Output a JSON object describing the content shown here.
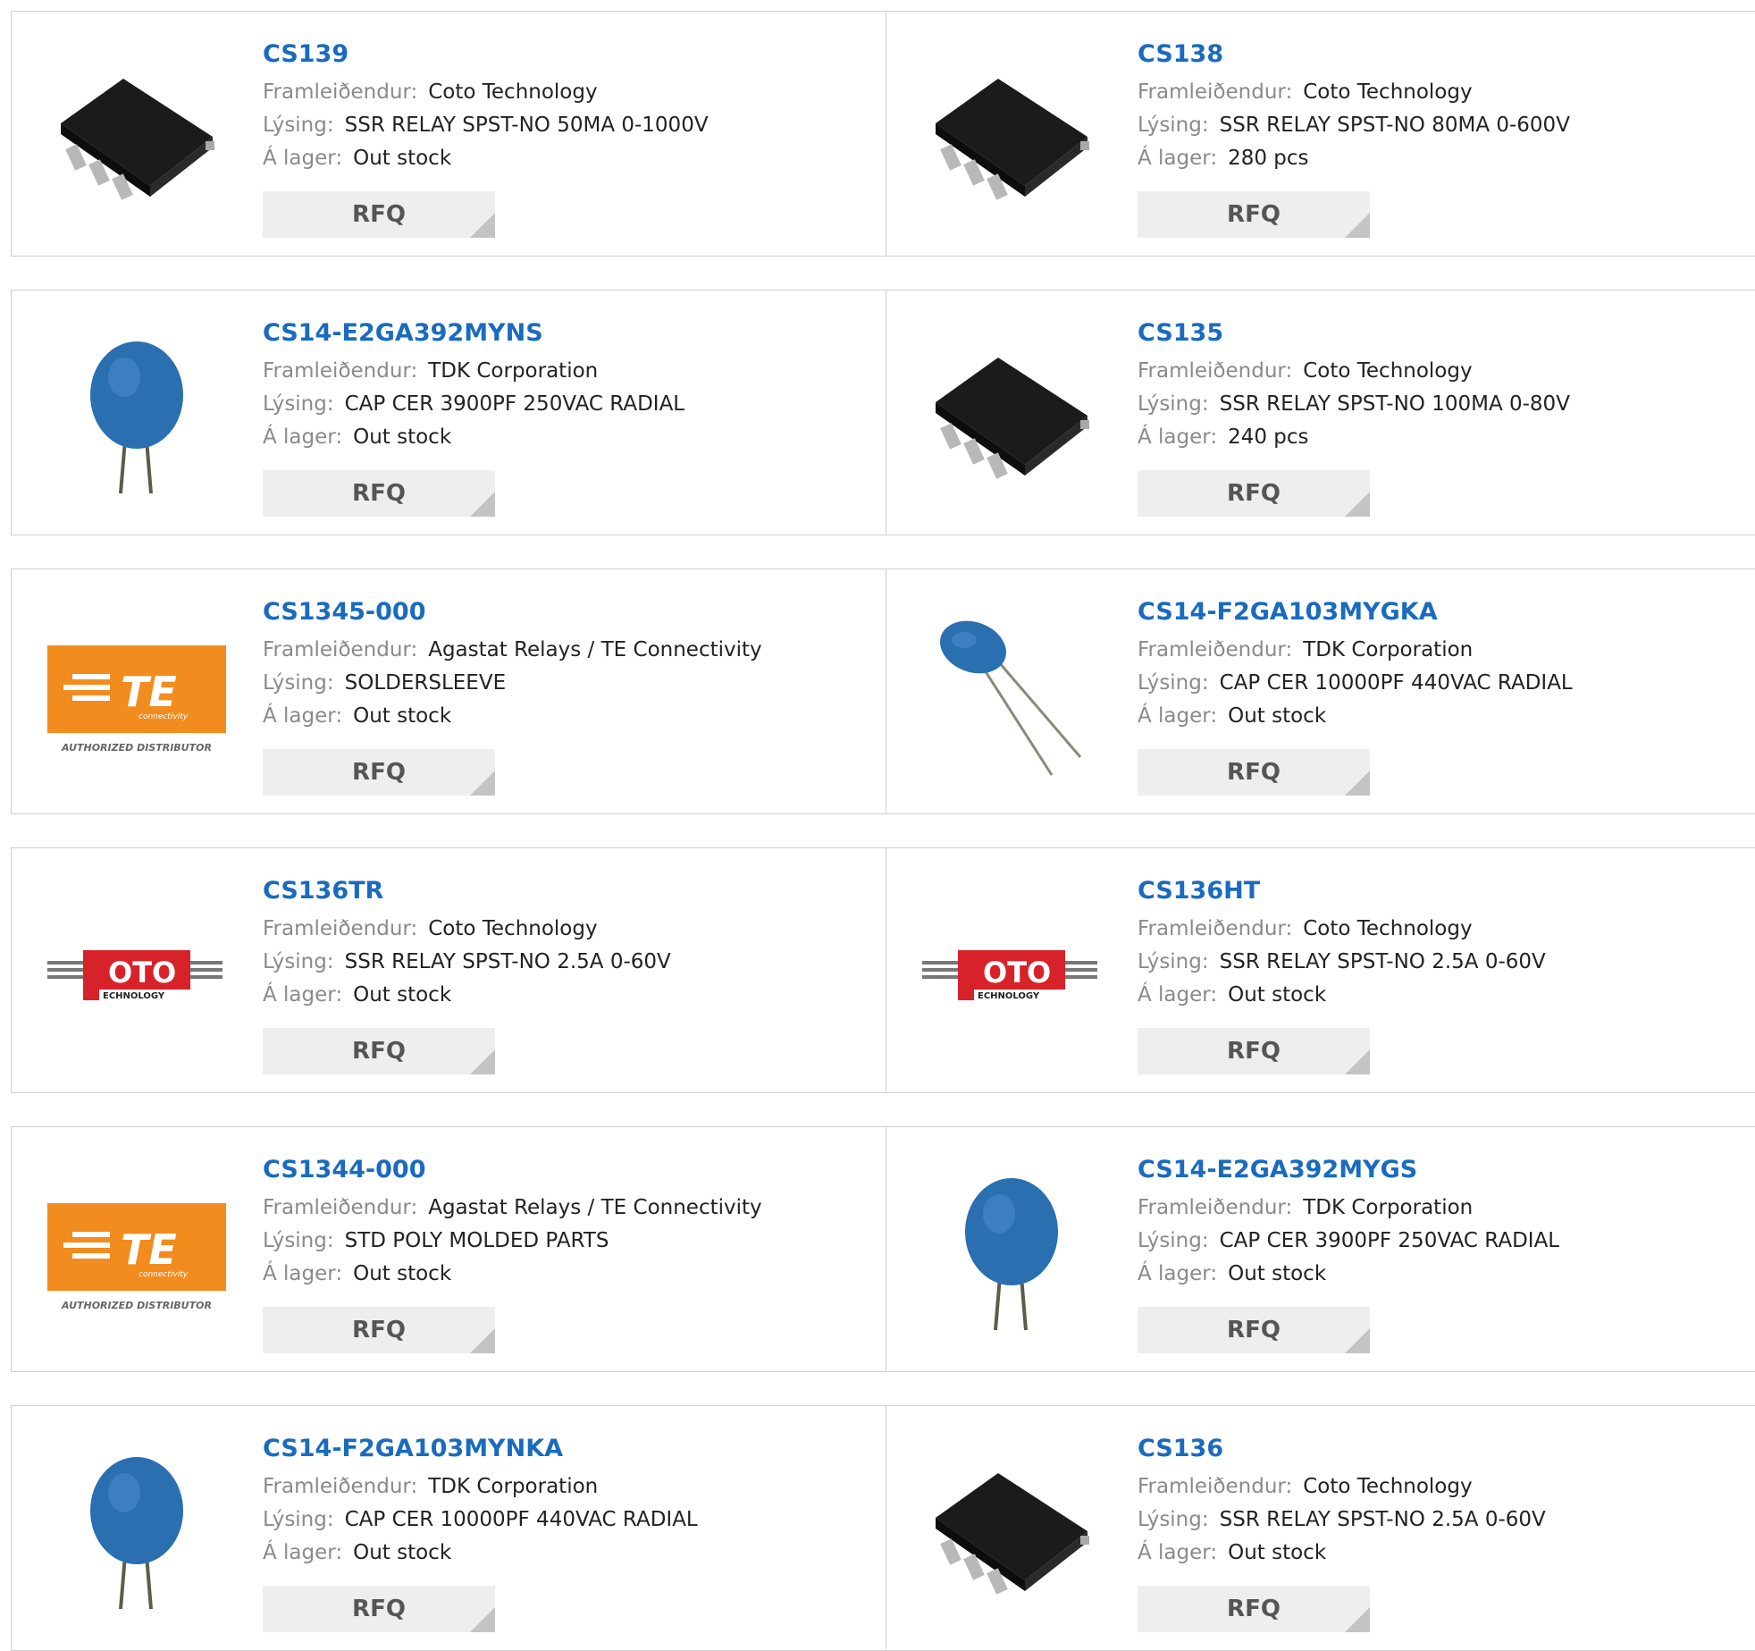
{
  "labels": {
    "manufacturer": "Framleiðendur:",
    "description": "Lýsing:",
    "stock": "Á lager:",
    "rfq": "RFQ"
  },
  "te_logo": {
    "brand": "TE",
    "sub": "connectivity",
    "tagline": "AUTHORIZED DISTRIBUTOR"
  },
  "coto_logo": {
    "brand": "OTO",
    "sub": "ECHNOLOGY"
  },
  "colors": {
    "link": "#1a6bbf",
    "te_orange": "#f28c1e",
    "coto_red": "#d8222a",
    "capacitor_blue": "#2a6fb0"
  },
  "rows": [
    [
      {
        "part": "CS139",
        "manufacturer": "Coto Technology",
        "description": "SSR RELAY SPST-NO 50MA 0-1000V",
        "stock": "Out stock",
        "image": "relay-chip"
      },
      {
        "part": "CS138",
        "manufacturer": "Coto Technology",
        "description": "SSR RELAY SPST-NO 80MA 0-600V",
        "stock": "280 pcs",
        "image": "relay-chip"
      }
    ],
    [
      {
        "part": "CS14-E2GA392MYNS",
        "manufacturer": "TDK Corporation",
        "description": "CAP CER 3900PF 250VAC RADIAL",
        "stock": "Out stock",
        "image": "capacitor"
      },
      {
        "part": "CS135",
        "manufacturer": "Coto Technology",
        "description": "SSR RELAY SPST-NO 100MA 0-80V",
        "stock": "240 pcs",
        "image": "relay-chip"
      }
    ],
    [
      {
        "part": "CS1345-000",
        "manufacturer": "Agastat Relays / TE Connectivity",
        "description": "SOLDERSLEEVE",
        "stock": "Out stock",
        "image": "te-logo"
      },
      {
        "part": "CS14-F2GA103MYGKA",
        "manufacturer": "TDK Corporation",
        "description": "CAP CER 10000PF 440VAC RADIAL",
        "stock": "Out stock",
        "image": "capacitor-tilted"
      }
    ],
    [
      {
        "part": "CS136TR",
        "manufacturer": "Coto Technology",
        "description": "SSR RELAY SPST-NO 2.5A 0-60V",
        "stock": "Out stock",
        "image": "coto-logo"
      },
      {
        "part": "CS136HT",
        "manufacturer": "Coto Technology",
        "description": "SSR RELAY SPST-NO 2.5A 0-60V",
        "stock": "Out stock",
        "image": "coto-logo"
      }
    ],
    [
      {
        "part": "CS1344-000",
        "manufacturer": "Agastat Relays / TE Connectivity",
        "description": "STD POLY MOLDED PARTS",
        "stock": "Out stock",
        "image": "te-logo"
      },
      {
        "part": "CS14-E2GA392MYGS",
        "manufacturer": "TDK Corporation",
        "description": "CAP CER 3900PF 250VAC RADIAL",
        "stock": "Out stock",
        "image": "capacitor"
      }
    ],
    [
      {
        "part": "CS14-F2GA103MYNKA",
        "manufacturer": "TDK Corporation",
        "description": "CAP CER 10000PF 440VAC RADIAL",
        "stock": "Out stock",
        "image": "capacitor"
      },
      {
        "part": "CS136",
        "manufacturer": "Coto Technology",
        "description": "SSR RELAY SPST-NO 2.5A 0-60V",
        "stock": "Out stock",
        "image": "relay-chip"
      }
    ]
  ]
}
